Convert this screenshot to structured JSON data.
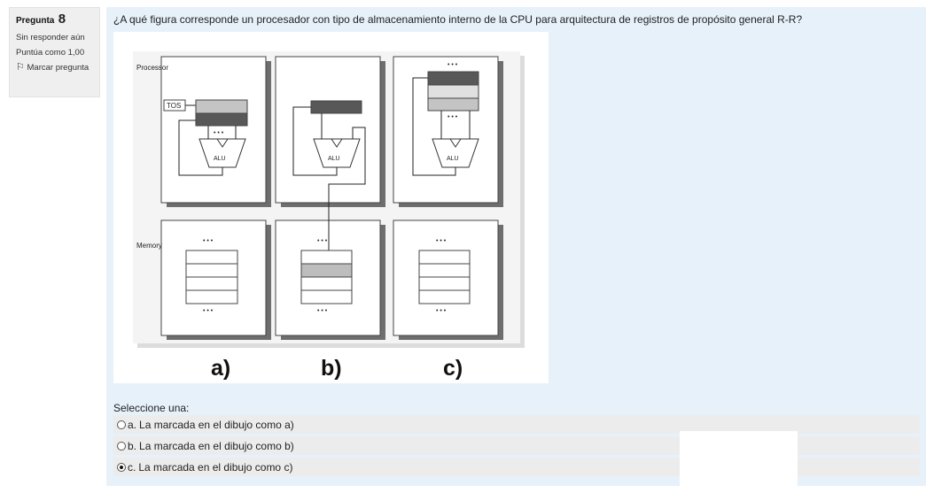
{
  "question_info": {
    "title_label": "Pregunta",
    "number": "8",
    "status": "Sin responder aún",
    "score": "Puntúa como 1,00",
    "flag_label": "Marcar pregunta"
  },
  "question": {
    "text": "¿A qué figura corresponde un procesador con tipo de almacenamiento interno de la CPU para arquitectura de registros de propósito general R-R?",
    "figure": {
      "processor_label": "Processor",
      "memory_label": "Memory",
      "tos_label": "TOS",
      "alu_label": "ALU",
      "ellipsis": "• • •",
      "captions": [
        "a)",
        "b)",
        "c)"
      ]
    },
    "prompt": "Seleccione una:",
    "options": [
      {
        "prefix": "a.",
        "label": "La marcada en el dibujo como a)",
        "selected": false
      },
      {
        "prefix": "b.",
        "label": "La marcada en el dibujo como b)",
        "selected": false
      },
      {
        "prefix": "c.",
        "label": "La marcada en el dibujo como c)",
        "selected": true
      }
    ]
  }
}
